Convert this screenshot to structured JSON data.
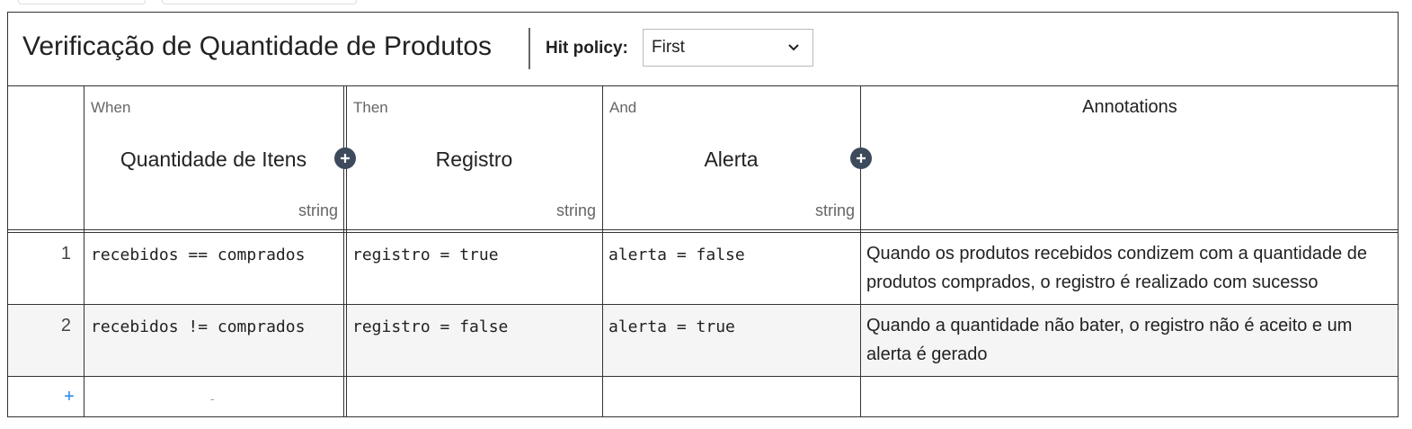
{
  "decision": {
    "title": "Verificação de Quantidade de Produtos",
    "hit_policy_label": "Hit policy:",
    "hit_policy_value": "First"
  },
  "columns": {
    "input": {
      "type_label": "When",
      "name": "Quantidade de Itens",
      "type_ref": "string"
    },
    "output1": {
      "type_label": "Then",
      "name": "Registro",
      "type_ref": "string"
    },
    "output2": {
      "type_label": "And",
      "name": "Alerta",
      "type_ref": "string"
    },
    "annotations": {
      "name": "Annotations"
    }
  },
  "rows": [
    {
      "num": "1",
      "input": "recebidos == comprados",
      "output1": "registro = true",
      "output2": "alerta = false",
      "annotation": "Quando os produtos recebidos condizem com a quantidade de produtos comprados, o registro é realizado com sucesso"
    },
    {
      "num": "2",
      "input": "recebidos != comprados",
      "output1": "registro = false",
      "output2": "alerta = true",
      "annotation": "Quando a quantidade não bater, o registro não é aceito e um alerta é gerado"
    }
  ],
  "add_row": {
    "plus": "+",
    "placeholder": "-"
  },
  "icons": {
    "add_column": "plus-circle-icon",
    "dropdown": "chevron-down-icon"
  }
}
